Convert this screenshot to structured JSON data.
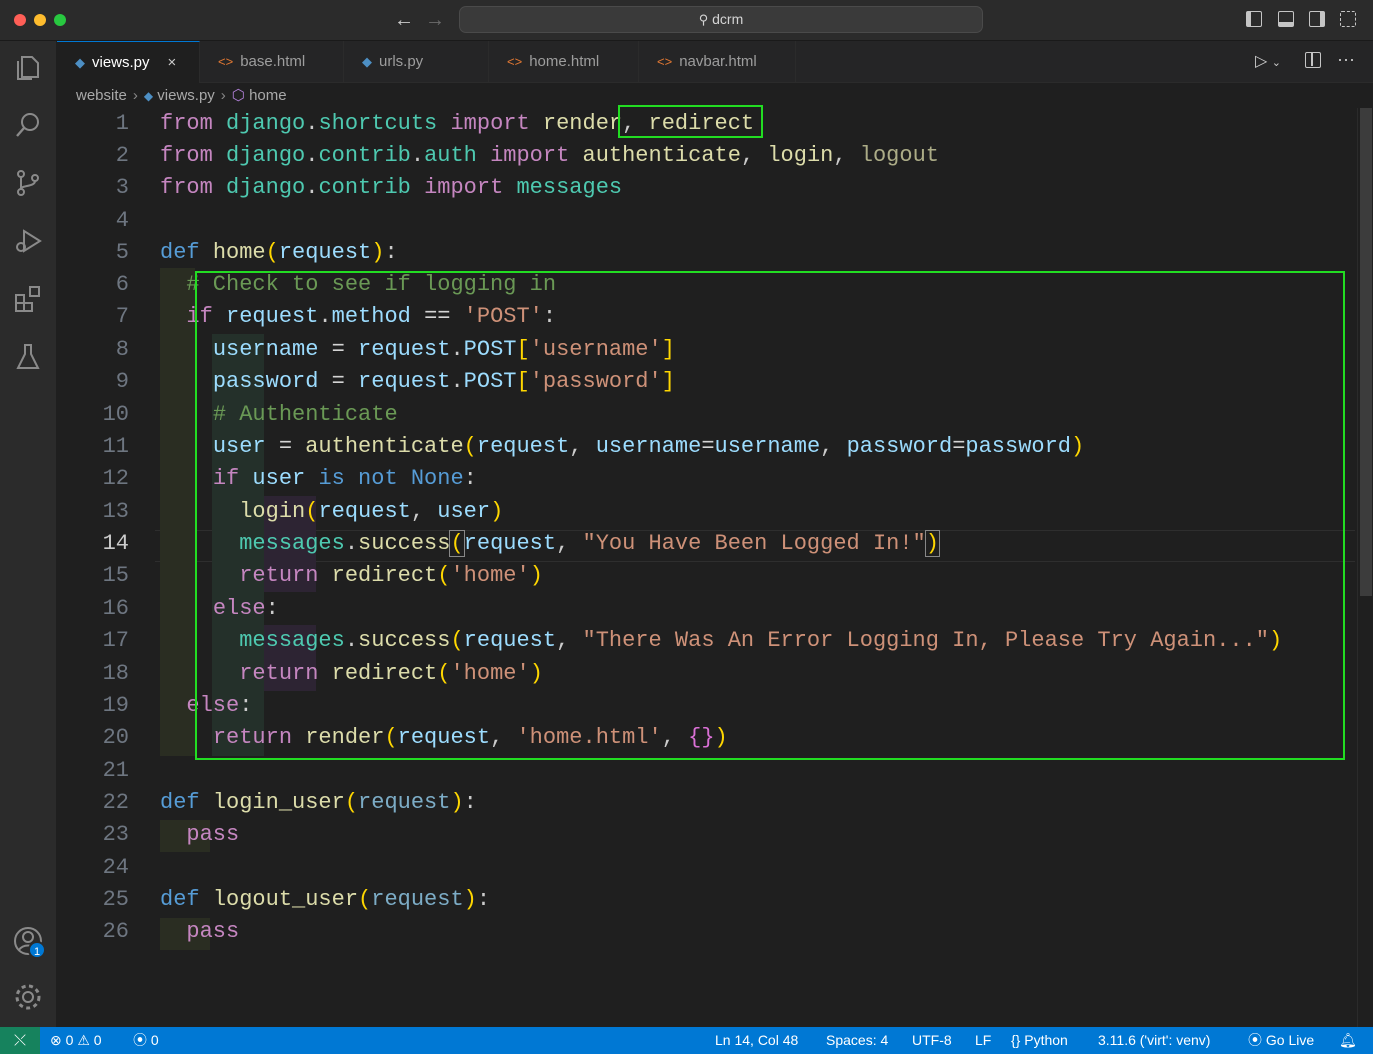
{
  "window": {
    "search": "dcrm"
  },
  "tabs": [
    {
      "label": "views.py",
      "type": "py",
      "active": true,
      "close": "×"
    },
    {
      "label": "base.html",
      "type": "html"
    },
    {
      "label": "urls.py",
      "type": "py"
    },
    {
      "label": "home.html",
      "type": "html"
    },
    {
      "label": "navbar.html",
      "type": "html"
    }
  ],
  "breadcrumb": {
    "folder": "website",
    "file": "views.py",
    "symbol": "home"
  },
  "editor": {
    "current_line": 14
  },
  "accounts_badge": "1",
  "status": {
    "errors": "0",
    "warnings": "0",
    "ports": "0",
    "position": "Ln 14, Col 48",
    "spaces": "Spaces: 4",
    "encoding": "UTF-8",
    "eol": "LF",
    "language": "Python",
    "interpreter": "3.11.6 ('virt': venv)",
    "golive": "Go Live"
  },
  "colors": {
    "highlight_box": "#22dd22",
    "statusbar": "#0078d4",
    "remote": "#16825d"
  },
  "icons": [
    "explorer-icon",
    "search-icon",
    "source-control-icon",
    "run-debug-icon",
    "extensions-icon",
    "testing-icon",
    "accounts-icon",
    "settings-icon"
  ]
}
